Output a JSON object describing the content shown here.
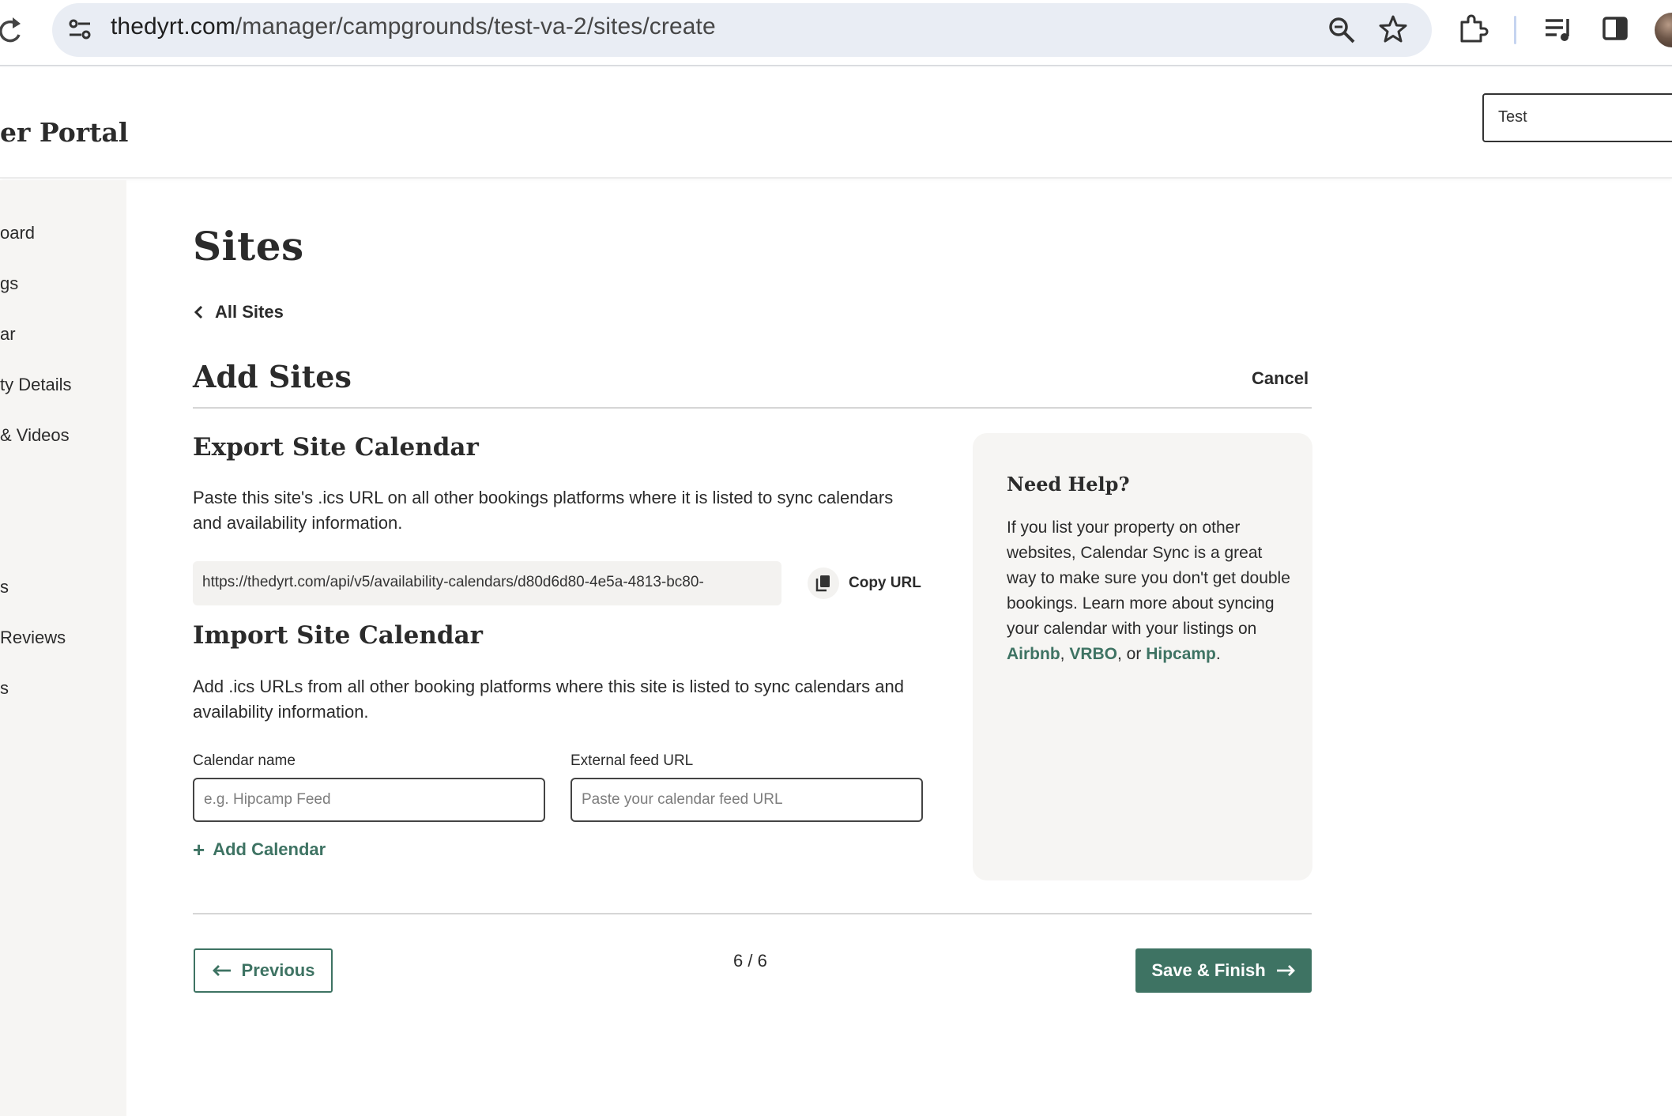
{
  "browser": {
    "url_host": "thedyrt.com",
    "url_path": "/manager/campgrounds/test-va-2/sites/create"
  },
  "header": {
    "portal_title": "er Portal",
    "campground_select_value": "Test"
  },
  "sidebar": {
    "items": [
      {
        "label": "oard"
      },
      {
        "label": "gs"
      },
      {
        "label": "ar"
      },
      {
        "label": "ty Details"
      },
      {
        "label": " & Videos"
      },
      {
        "label": "s"
      },
      {
        "label": "Reviews"
      },
      {
        "label": "s"
      }
    ]
  },
  "main": {
    "page_title": "Sites",
    "back_link": "All Sites",
    "section_title": "Add Sites",
    "cancel_label": "Cancel",
    "export": {
      "title": "Export Site Calendar",
      "description": "Paste this site's .ics URL on all other bookings platforms where it is listed to sync calendars and availability information.",
      "url": "https://thedyrt.com/api/v5/availability-calendars/d80d6d80-4e5a-4813-bc80-",
      "copy_label": "Copy URL"
    },
    "import": {
      "title": "Import Site Calendar",
      "description": "Add .ics URLs from all other booking platforms where this site is listed to sync calendars and availability information.",
      "calendar_name_label": "Calendar name",
      "calendar_name_placeholder": "e.g. Hipcamp Feed",
      "feed_url_label": "External feed URL",
      "feed_url_placeholder": "Paste your calendar feed URL",
      "add_calendar_label": "Add Calendar"
    },
    "help": {
      "title": "Need Help?",
      "text_before": "If you list your property on other websites, Calendar Sync is a great way to make sure you don't get double bookings. Learn more about syncing your calendar with your listings on ",
      "link_airbnb": "Airbnb",
      "sep1": ", ",
      "link_vrbo": "VRBO",
      "sep2": ", or ",
      "link_hipcamp": "Hipcamp",
      "text_after": "."
    },
    "footer": {
      "previous_label": "Previous",
      "step": "6 / 6",
      "save_label": "Save & Finish"
    }
  },
  "colors": {
    "accent": "#3e7363",
    "sidebar_bg": "#f6f5f3",
    "omnibox_bg": "#e9edf4"
  }
}
